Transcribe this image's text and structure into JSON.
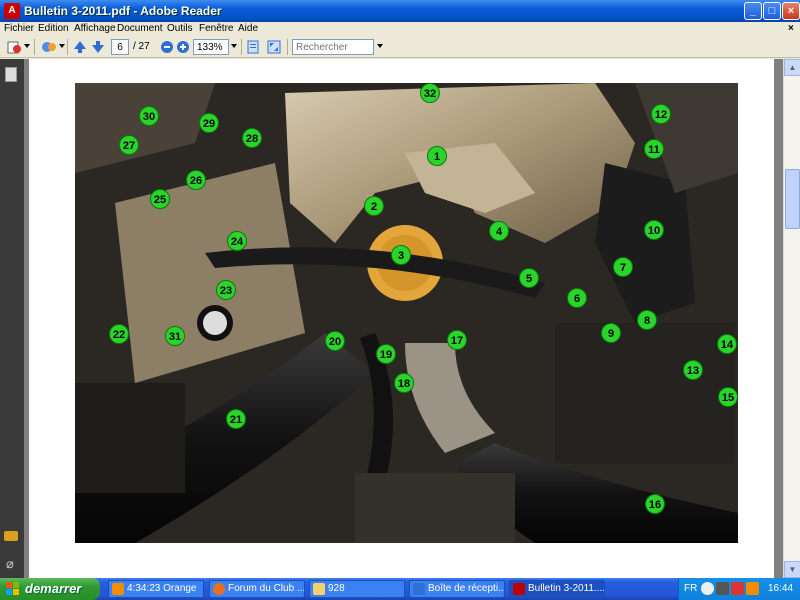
{
  "window": {
    "title": "Bulletin 3-2011.pdf - Adobe Reader",
    "minimize": "_",
    "maximize": "□",
    "close": "×"
  },
  "menubar": {
    "items": [
      "Fichier",
      "Edition",
      "Affichage",
      "Document",
      "Outils",
      "Fenêtre",
      "Aide"
    ],
    "close_doc": "×"
  },
  "toolbar": {
    "current_page": "6",
    "page_total": "/ 27",
    "zoom": "133%",
    "search_placeholder": "Rechercher"
  },
  "photo": {
    "callouts": [
      "1",
      "2",
      "3",
      "4",
      "5",
      "6",
      "7",
      "8",
      "9",
      "10",
      "11",
      "12",
      "13",
      "14",
      "15",
      "16",
      "17",
      "18",
      "19",
      "20",
      "21",
      "22",
      "23",
      "24",
      "25",
      "26",
      "27",
      "28",
      "29",
      "30",
      "31",
      "32"
    ]
  },
  "taskbar": {
    "start_label": "demarrer",
    "tasks": [
      {
        "label": "4:34:23 Orange",
        "color": "#f28c00"
      },
      {
        "label": "Forum du Club ...",
        "color": "#e8701a"
      },
      {
        "label": "928",
        "color": "#f3d26a"
      },
      {
        "label": "Boîte de récepti...",
        "color": "#2f6fd4"
      },
      {
        "label": "Bulletin 3-2011....",
        "color": "#c00000"
      }
    ],
    "tray": {
      "language": "FR",
      "clock": "16:44"
    }
  }
}
